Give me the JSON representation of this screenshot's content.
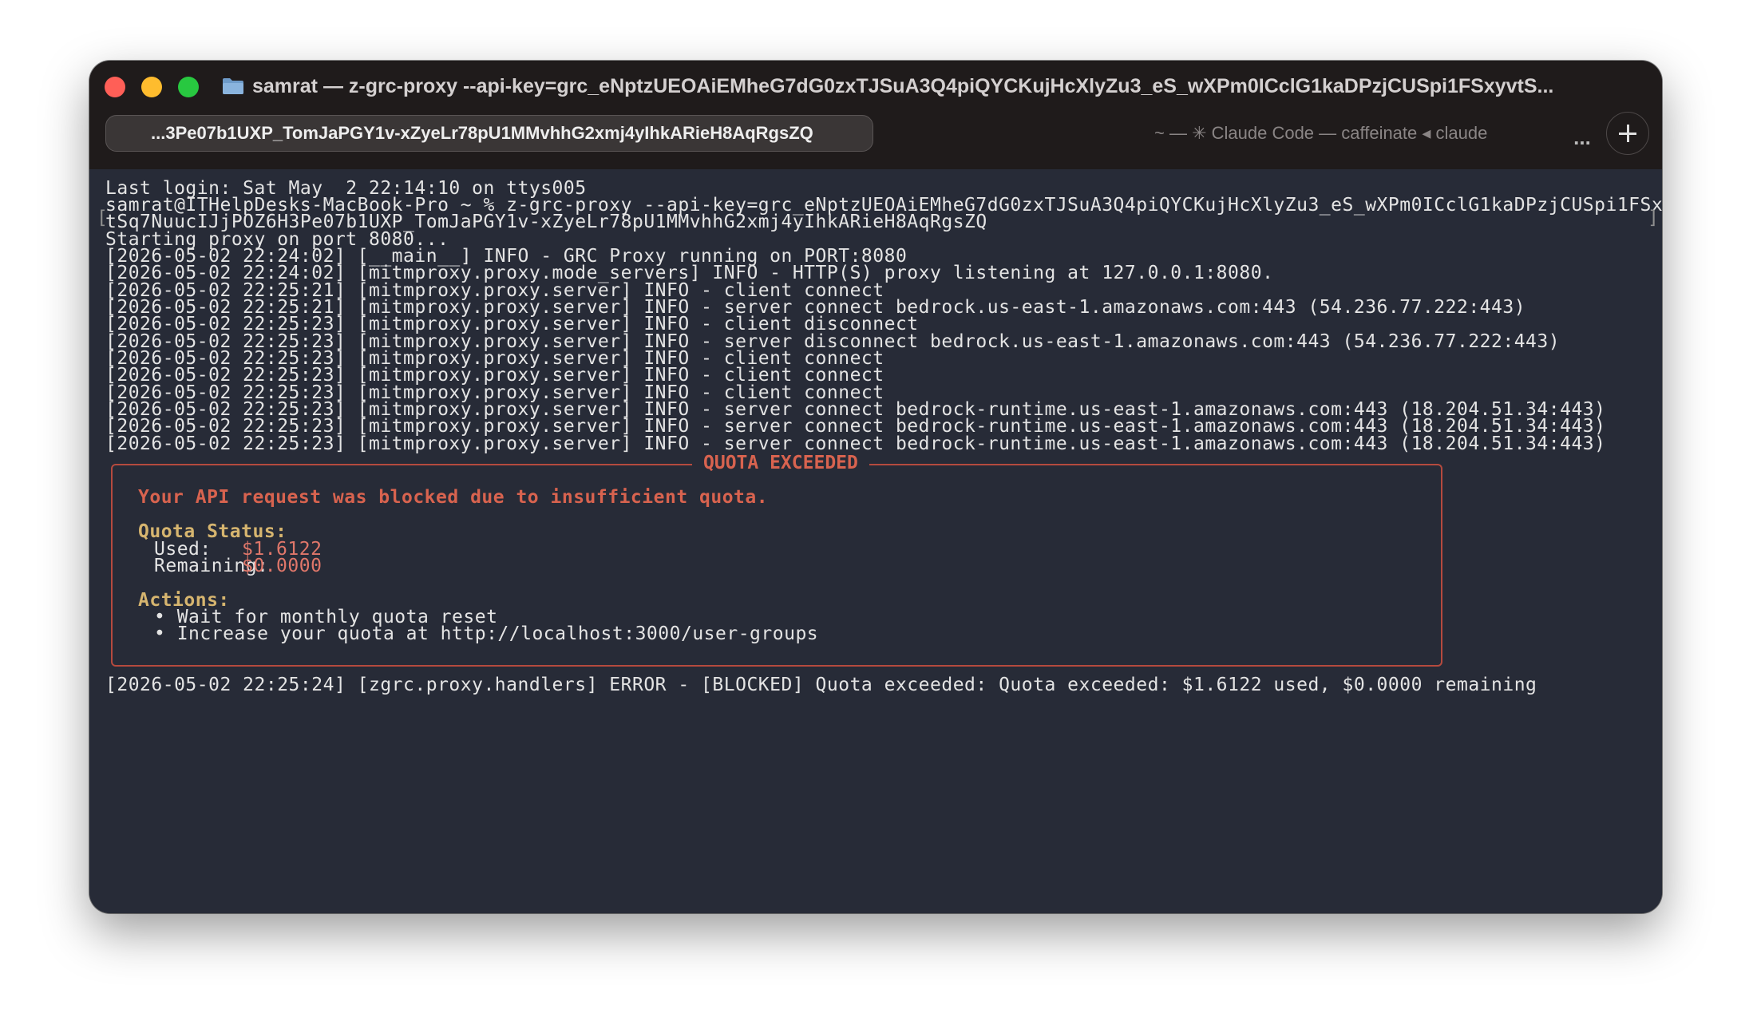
{
  "window": {
    "title": "samrat — z-grc-proxy --api-key=grc_eNptzUEOAiEMheG7dG0zxTJSuA3Q4piQYCKujHcXlyZu3_eS_wXPm0ICclG1kaDPzjCUSpi1FSxyvtS...",
    "active_tab": "...3Pe07b1UXP_TomJaPGY1v-xZyeLr78pU1MMvhhG2xmj4yIhkARieH8AqRgsZQ",
    "inactive_tab": "~ — ✳ Claude Code — caffeinate ◂ claude",
    "overflow_label": "...",
    "colors": {
      "background": "#272b37",
      "titlebar": "#1f1b1b",
      "accent_red": "#d8634f",
      "accent_gold": "#d6b56f"
    }
  },
  "terminal": {
    "lines": [
      "Last login: Sat May  2 22:14:10 on ttys005",
      "samrat@ITHelpDesks-MacBook-Pro ~ % z-grc-proxy --api-key=grc_eNptzUEOAiEMheG7dG0zxTJSuA3Q4piQYCKujHcXlyZu3_eS_wXPm0ICclG1kaDPzjCUSpi1FSxyv",
      "tSq7NuucIJjPOZ6H3Pe07b1UXP_TomJaPGY1v-xZyeLr78pU1MMvhhG2xmj4yIhkARieH8AqRgsZQ",
      "Starting proxy on port 8080...",
      "[2026-05-02 22:24:02] [__main__] INFO - GRC Proxy running on PORT:8080",
      "[2026-05-02 22:24:02] [mitmproxy.proxy.mode_servers] INFO - HTTP(S) proxy listening at 127.0.0.1:8080.",
      "[2026-05-02 22:25:21] [mitmproxy.proxy.server] INFO - client connect",
      "[2026-05-02 22:25:21] [mitmproxy.proxy.server] INFO - server connect bedrock.us-east-1.amazonaws.com:443 (54.236.77.222:443)",
      "[2026-05-02 22:25:23] [mitmproxy.proxy.server] INFO - client disconnect",
      "[2026-05-02 22:25:23] [mitmproxy.proxy.server] INFO - server disconnect bedrock.us-east-1.amazonaws.com:443 (54.236.77.222:443)",
      "[2026-05-02 22:25:23] [mitmproxy.proxy.server] INFO - client connect",
      "[2026-05-02 22:25:23] [mitmproxy.proxy.server] INFO - client connect",
      "[2026-05-02 22:25:23] [mitmproxy.proxy.server] INFO - client connect",
      "[2026-05-02 22:25:23] [mitmproxy.proxy.server] INFO - server connect bedrock-runtime.us-east-1.amazonaws.com:443 (18.204.51.34:443)",
      "[2026-05-02 22:25:23] [mitmproxy.proxy.server] INFO - server connect bedrock-runtime.us-east-1.amazonaws.com:443 (18.204.51.34:443)",
      "[2026-05-02 22:25:23] [mitmproxy.proxy.server] INFO - server connect bedrock-runtime.us-east-1.amazonaws.com:443 (18.204.51.34:443)"
    ],
    "quota": {
      "title": "QUOTA EXCEEDED",
      "message": "Your API request was blocked due to insufficient quota.",
      "status_heading": "Quota Status:",
      "used_label": "Used:",
      "used_value": "$1.6122",
      "remaining_label": "Remaining:",
      "remaining_value": "$0.0000",
      "actions_heading": "Actions:",
      "actions": [
        "• Wait for monthly quota reset",
        "• Increase your quota at http://localhost:3000/user-groups"
      ]
    },
    "error_line": "[2026-05-02 22:25:24] [zgrc.proxy.handlers] ERROR - [BLOCKED] Quota exceeded: Quota exceeded: $1.6122 used, $0.0000 remaining"
  }
}
